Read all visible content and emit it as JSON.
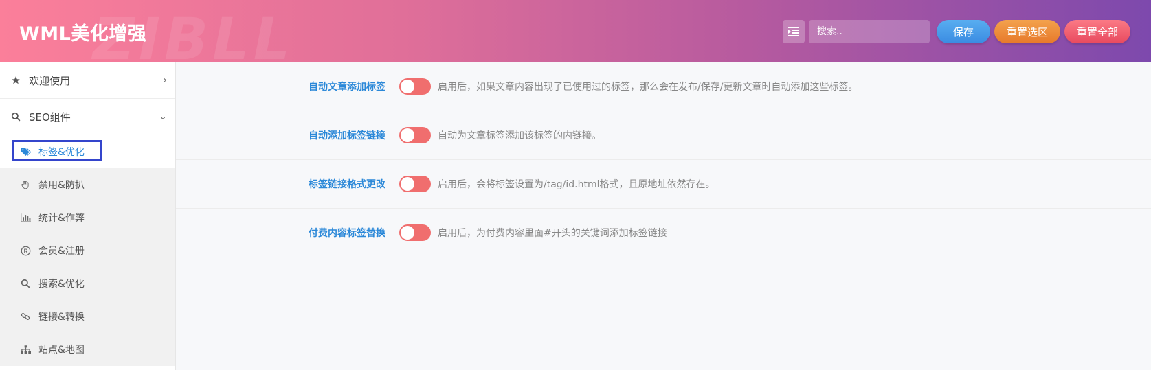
{
  "header": {
    "brand": "WML美化增强",
    "watermark": "ZIBLL",
    "search_placeholder": "搜索..",
    "save_label": "保存",
    "reset_section_label": "重置选区",
    "reset_all_label": "重置全部"
  },
  "sidebar": {
    "items": [
      {
        "label": "欢迎使用",
        "icon": "star-icon"
      },
      {
        "label": "SEO组件",
        "icon": "search-icon"
      }
    ],
    "subitems": [
      {
        "label": "标签&优化",
        "icon": "tags-icon",
        "active": true
      },
      {
        "label": "禁用&防扒",
        "icon": "hand-icon"
      },
      {
        "label": "统计&作弊",
        "icon": "bar-chart-icon"
      },
      {
        "label": "会员&注册",
        "icon": "registered-icon"
      },
      {
        "label": "搜索&优化",
        "icon": "search-icon"
      },
      {
        "label": "链接&转换",
        "icon": "link-icon"
      },
      {
        "label": "站点&地图",
        "icon": "sitemap-icon"
      }
    ]
  },
  "settings": [
    {
      "label": "自动文章添加标签",
      "desc": "启用后，如果文章内容出现了已使用过的标签，那么会在发布/保存/更新文章时自动添加这些标签。",
      "enabled": false
    },
    {
      "label": "自动添加标签链接",
      "desc": "自动为文章标签添加该标签的内链接。",
      "enabled": false
    },
    {
      "label": "标签链接格式更改",
      "desc": "启用后，会将标签设置为/tag/id.html格式，且原地址依然存在。",
      "enabled": false
    },
    {
      "label": "付费内容标签替换",
      "desc": "启用后，为付费内容里面#开头的关键词添加标签链接",
      "enabled": false
    }
  ],
  "colors": {
    "accent": "#2b88d8",
    "toggle": "#f06e6e",
    "save": "#3b8be2",
    "reset_section": "#e7792b",
    "reset_all": "#e84a5f"
  }
}
